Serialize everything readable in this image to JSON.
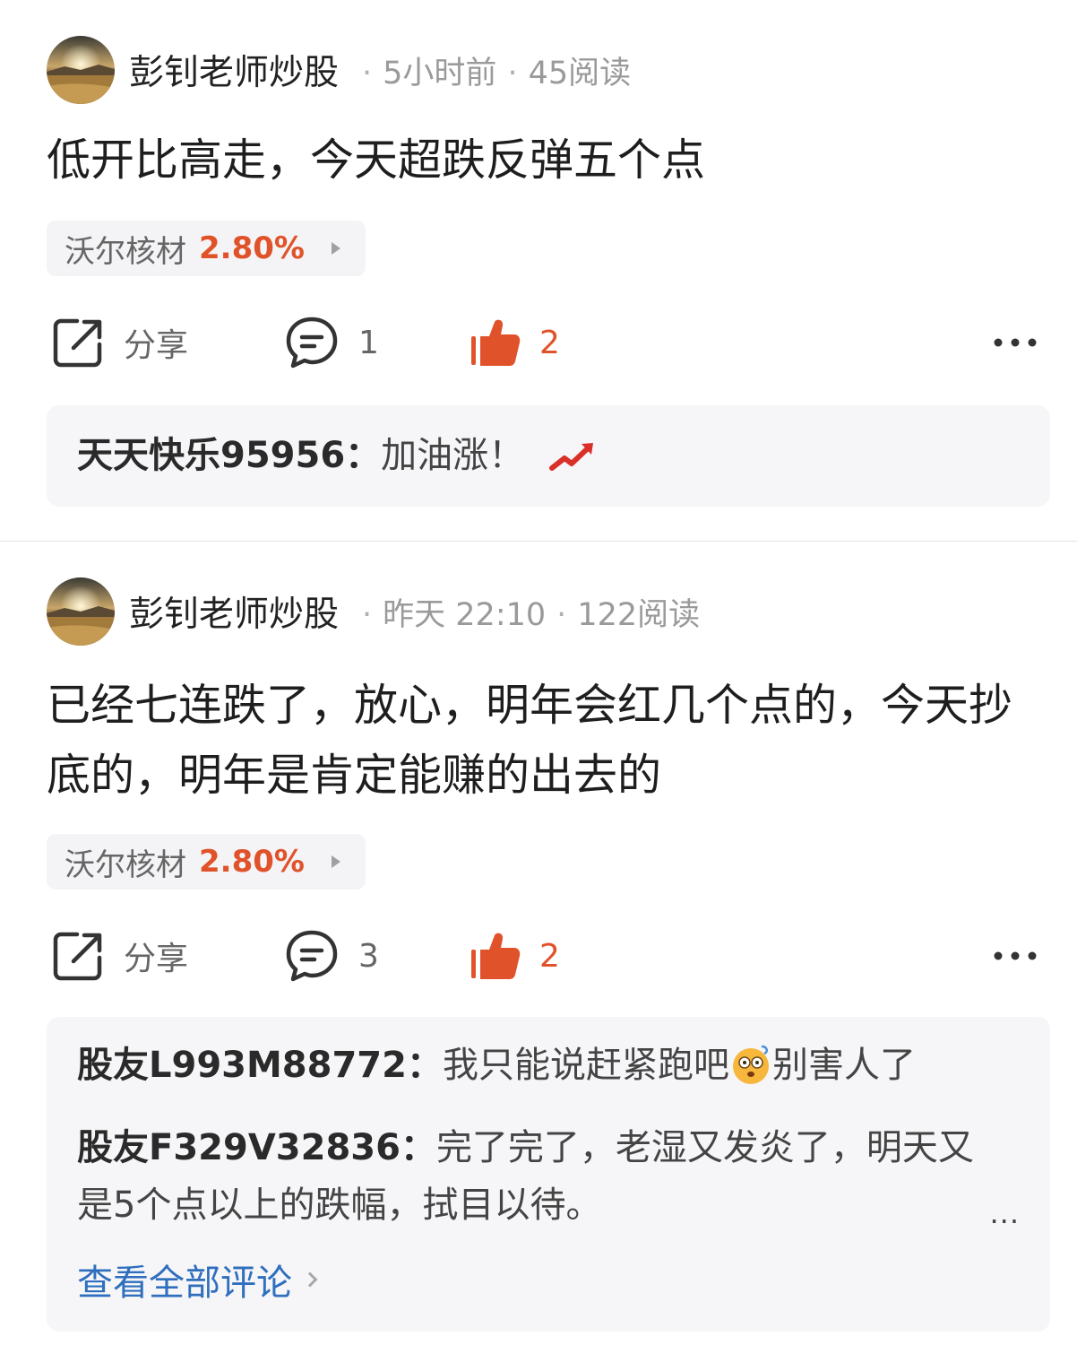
{
  "posts": [
    {
      "author": "彭钊老师炒股",
      "time": "5小时前",
      "reads": "45阅读",
      "content": "低开比高走，今天超跌反弹五个点",
      "stock": {
        "name": "沃尔核材",
        "change": "2.80%"
      },
      "actions": {
        "share_label": "分享",
        "comment_count": "1",
        "like_count": "2"
      },
      "comments": [
        {
          "user": "天天快乐95956：",
          "text": "加油涨！",
          "icon": "trend-up-icon"
        }
      ]
    },
    {
      "author": "彭钊老师炒股",
      "time": "昨天 22:10",
      "reads": "122阅读",
      "content": "已经七连跌了，放心，明年会红几个点的，今天抄底的，明年是肯定能赚的出去的",
      "stock": {
        "name": "沃尔核材",
        "change": "2.80%"
      },
      "actions": {
        "share_label": "分享",
        "comment_count": "3",
        "like_count": "2"
      },
      "comments": [
        {
          "user": "股友L993M88772：",
          "text_before": "我只能说赶紧跑吧",
          "icon": "dizzy-face-emoji",
          "text_after": "别害人了"
        },
        {
          "user": "股友F329V32836：",
          "text": "完了完了，老湿又发炎了，明天又是5个点以上的跌幅，拭目以待。"
        }
      ],
      "more_label": "...",
      "view_all_label": "查看全部评论"
    }
  ],
  "colors": {
    "accent_red": "#e0532a",
    "link_blue": "#2f6fbd",
    "meta_gray": "#9a9a9a",
    "comment_bg": "#f6f6f8"
  }
}
